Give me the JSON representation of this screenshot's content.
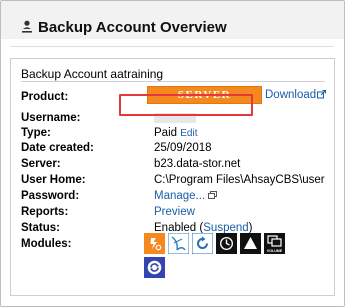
{
  "header": {
    "title": "Backup Account Overview",
    "icon": "user-icon"
  },
  "card": {
    "title": "Backup Account aatraining",
    "rows": {
      "product": {
        "label": "Product:",
        "badge": "SERVER",
        "download_label": "Download"
      },
      "username": {
        "label": "Username:"
      },
      "type": {
        "label": "Type:",
        "value": "Paid",
        "edit_label": "Edit"
      },
      "date_created": {
        "label": "Date created:",
        "value": "25/09/2018"
      },
      "server": {
        "label": "Server:",
        "value": "b23.data-stor.net"
      },
      "user_home": {
        "label": "User Home:",
        "value": "C:\\Program Files\\AhsayCBS\\user"
      },
      "password": {
        "label": "Password:",
        "manage_label": "Manage..."
      },
      "reports": {
        "label": "Reports:",
        "preview_label": "Preview"
      },
      "status": {
        "label": "Status:",
        "value": "Enabled",
        "suspend_open": "(",
        "suspend_label": "Suspend",
        "suspend_close": ")"
      },
      "modules": {
        "label": "Modules:",
        "icons": [
          {
            "name": "run-on-server-module-icon",
            "color": "#f5891f"
          },
          {
            "name": "ms-sql-module-icon",
            "color": "#2a7fc1"
          },
          {
            "name": "continuous-backup-module-icon",
            "color": "#1f6fb8"
          },
          {
            "name": "scheduler-module-icon",
            "color": "#111111"
          },
          {
            "name": "warning-triangle-module-icon",
            "color": "#111111"
          },
          {
            "name": "volume-module-icon",
            "color": "#111111",
            "caption": "VOLUME"
          },
          {
            "name": "sync-module-icon",
            "color": "#3346b0"
          }
        ]
      }
    }
  },
  "colors": {
    "link": "#1a5ea8",
    "badge": "#f5891f",
    "highlight": "#e23a3a"
  }
}
